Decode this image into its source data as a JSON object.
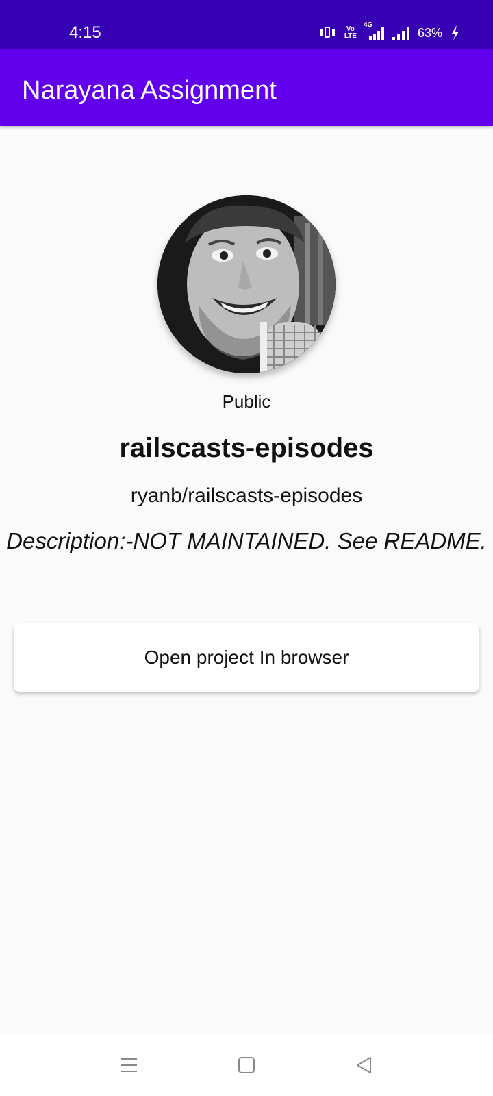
{
  "status_bar": {
    "time": "4:15",
    "volte_top": "Vo",
    "volte_bottom": "LTE",
    "network_type": "4G",
    "battery": "63%",
    "icons": [
      "vibrate-icon",
      "volte-icon",
      "network-4g-icon",
      "signal-icon",
      "charging-icon"
    ]
  },
  "app_bar": {
    "title": "Narayana Assignment"
  },
  "repo": {
    "visibility": "Public",
    "name": "railscasts-episodes",
    "full_name": "ryanb/railscasts-episodes",
    "description": "Description:-NOT MAINTAINED. See README."
  },
  "actions": {
    "open_browser_label": "Open project In browser"
  },
  "nav_bar": {
    "icons": [
      "menu-icon",
      "home-icon",
      "back-icon"
    ]
  },
  "colors": {
    "status_bar": "#3700B3",
    "app_bar": "#6200EE",
    "background": "#FAFAFA"
  }
}
